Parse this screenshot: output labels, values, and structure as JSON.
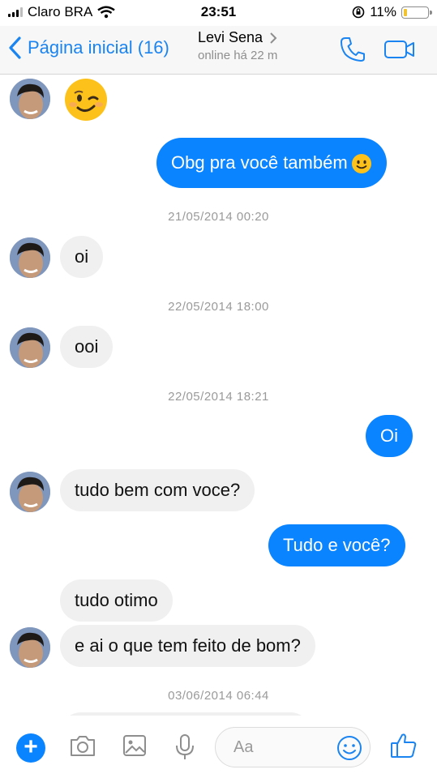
{
  "status_bar": {
    "carrier": "Claro BRA",
    "time": "23:51",
    "battery_text": "11%",
    "battery_level": 0.11
  },
  "header": {
    "back_label": "Página inicial (16)",
    "contact_name": "Levi Sena",
    "contact_status": "online há 22 m"
  },
  "messages": {
    "m1": "Obg pra você também",
    "t1": "21/05/2014 00:20",
    "m2": "oi",
    "t2": "22/05/2014 18:00",
    "m3": "ooi",
    "t3": "22/05/2014 18:21",
    "m4": "Oi",
    "m5": "tudo bem com voce?",
    "m6": "Tudo e você?",
    "m7": "tudo otimo",
    "m8": "e ai o que tem feito de bom?",
    "t4": "03/06/2014 06:44"
  },
  "composer": {
    "placeholder": "Aa"
  },
  "colors": {
    "accent": "#0a84ff",
    "incoming_bubble": "#f0f0f0",
    "battery": "#f1c232"
  }
}
